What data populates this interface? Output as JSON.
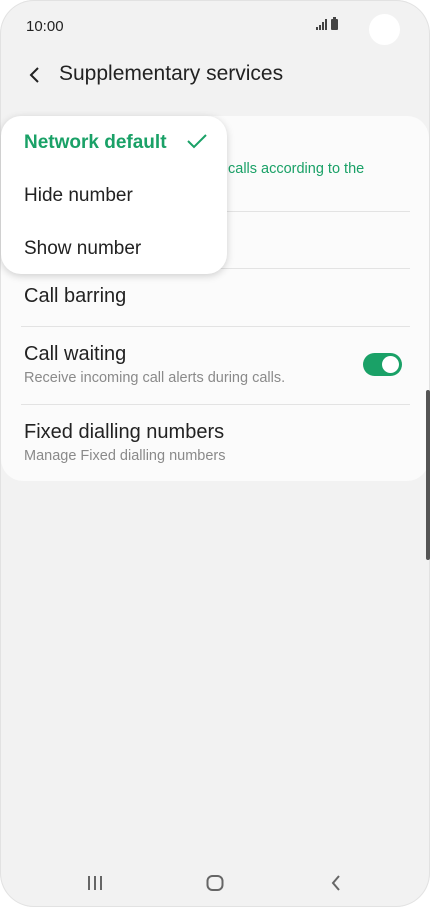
{
  "status_bar": {
    "time": "10:00"
  },
  "header": {
    "title": "Supplementary services"
  },
  "dropdown": {
    "options": [
      {
        "label": "Network default",
        "selected": true
      },
      {
        "label": "Hide number",
        "selected": false
      },
      {
        "label": "Show number",
        "selected": false
      }
    ]
  },
  "settings": {
    "caller_id_subtitle": "calls according to the",
    "call_barring": {
      "title": "Call barring"
    },
    "call_waiting": {
      "title": "Call waiting",
      "subtitle": "Receive incoming call alerts during calls.",
      "enabled": true
    },
    "fixed_dialling": {
      "title": "Fixed dialling numbers",
      "subtitle": "Manage Fixed dialling numbers"
    }
  },
  "colors": {
    "accent": "#1aa167",
    "background": "#f2f2f2",
    "card": "#fbfbfb"
  },
  "icons": {
    "back": "chevron-left-icon",
    "check": "check-icon",
    "nav_recent": "recent-apps-icon",
    "nav_home": "home-icon",
    "nav_back": "back-icon"
  }
}
